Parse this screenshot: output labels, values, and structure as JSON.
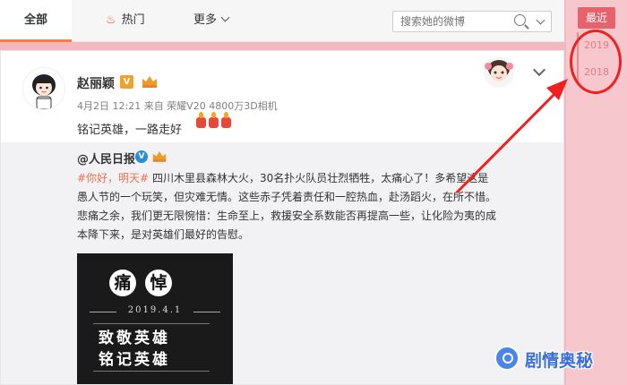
{
  "tabs": {
    "all": "全部",
    "hot": "热门",
    "more": "更多"
  },
  "search": {
    "placeholder": "搜索她的微博"
  },
  "year_nav": {
    "latest": "最近",
    "years": [
      "2019",
      "2018"
    ]
  },
  "post": {
    "username": "赵丽颖",
    "verified_mark": "V",
    "meta": "4月2日 12:21 来自 荣耀V20 4800万3D相机",
    "text": "铭记英雄，一路走好"
  },
  "repost": {
    "author": "@人民日报",
    "verified_mark": "V",
    "hashtag": "#你好，明天#",
    "text": "四川木里县森林大火，30名扑火队员壮烈牺牲，太痛心了！多希望这是愚人节的一个玩笑，但灾难无情。这些赤子凭着责任和一腔热血，赴汤蹈火，在所不惜。悲痛之余，我们更无限惋惜：生命至上，救援安全系数能否再提高一些，让化险为夷的成本降下来，是对英雄们最好的告慰。",
    "image": {
      "char1": "痛",
      "char2": "悼",
      "date": "2019.4.1",
      "line1": "致敬英雄",
      "line2": "铭记英雄"
    }
  },
  "watermark": {
    "text": "剧情奥秘"
  },
  "colors": {
    "accent": "#fa7d3c",
    "latest_bg": "#e6626d",
    "annotation_red": "#ef2020",
    "hashtag": "#eb7350"
  }
}
